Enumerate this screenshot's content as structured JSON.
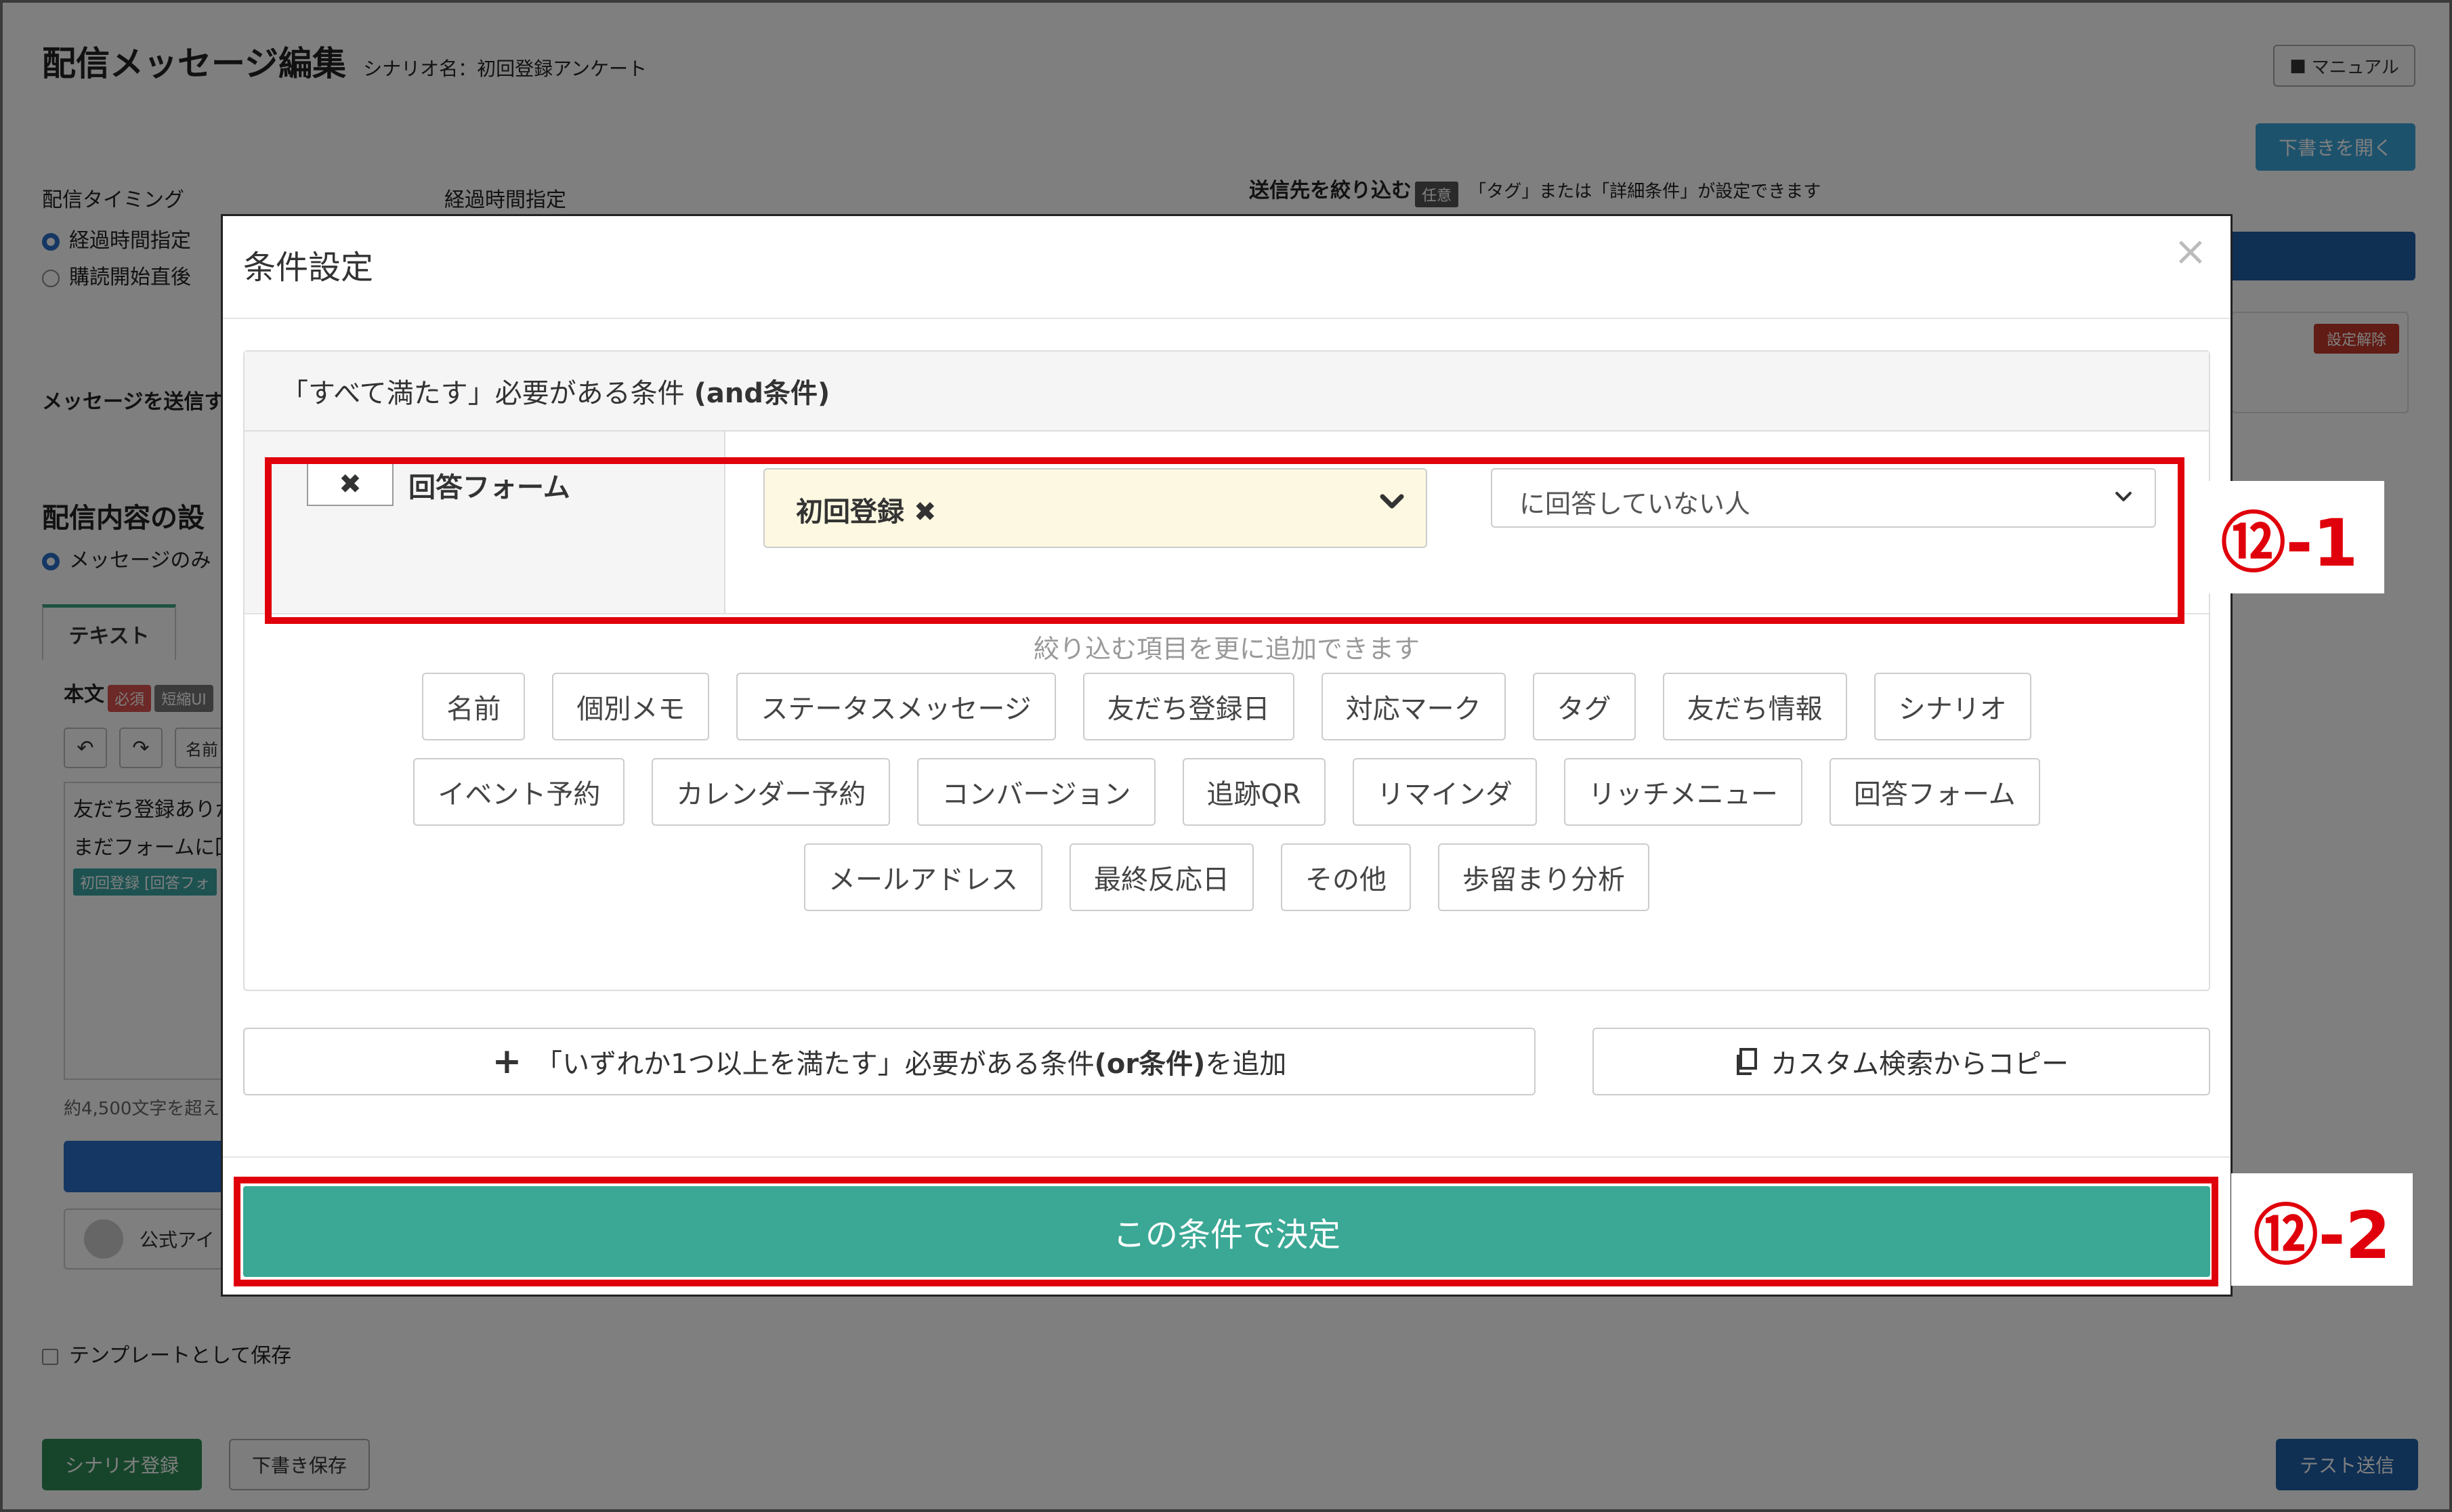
{
  "background": {
    "page_title": "配信メッセージ編集",
    "scenario_label": "シナリオ名：初回登録アンケート",
    "manual_button": "マニュアル",
    "open_draft_button": "下書きを開く",
    "timing_label": "配信タイミング",
    "timing_options": [
      "経過時間指定",
      "購読開始直後"
    ],
    "elapsed_label": "経過時間指定",
    "narrow_label": "送信先を絞り込む",
    "narrow_badge": "任意",
    "narrow_note": "「タグ」または「詳細条件」が設定できます",
    "reset_button": "設定解除",
    "send_message_label": "メッセージを送信す",
    "content_label": "配信内容の設",
    "content_option": "メッセージのみ",
    "text_tab": "テキスト",
    "body_label": "本文",
    "required_badge": "必須",
    "short_badge": "短縮UI",
    "name_button": "名前",
    "body_text_1": "友だち登録ありが",
    "body_text_2": "まだフォームに回",
    "body_chip": "初回登録 [回答フォ",
    "char_limit": "約4,500文字を超え",
    "account_name": "公式アイ",
    "template_save": "テンプレートとして保存",
    "scenario_register_button": "シナリオ登録",
    "draft_save_button": "下書き保存",
    "test_send_button": "テスト送信"
  },
  "modal": {
    "title": "条件設定",
    "close_symbol": "×",
    "and_header": "「すべて満たす」必要がある条件",
    "and_header_bold": "(and条件)",
    "condition": {
      "remove_symbol": "✖",
      "name": "回答フォーム",
      "selected_form": "初回登録",
      "selected_form_remove": "✖",
      "answer_status": "に回答していない人"
    },
    "hint": "絞り込む項目を更に追加できます",
    "tag_rows": [
      [
        "名前",
        "個別メモ",
        "ステータスメッセージ",
        "友だち登録日",
        "対応マーク",
        "タグ",
        "友だち情報",
        "シナリオ"
      ],
      [
        "イベント予約",
        "カレンダー予約",
        "コンバージョン",
        "追跡QR",
        "リマインダ",
        "リッチメニュー",
        "回答フォーム"
      ],
      [
        "メールアドレス",
        "最終反応日",
        "その他",
        "歩留まり分析"
      ]
    ],
    "or_button_prefix": "「いずれか1つ以上を満たす」必要がある条件",
    "or_button_bold": "(or条件)",
    "or_button_suffix": "を追加",
    "copy_button": "カスタム検索からコピー",
    "decide_button": "この条件で決定"
  },
  "callouts": {
    "step1": "⑫-1",
    "step2": "⑫-2"
  },
  "colors": {
    "decide": "#3aa895",
    "highlight": "#e0000b",
    "selected_form_bg": "#fdf8e1"
  }
}
